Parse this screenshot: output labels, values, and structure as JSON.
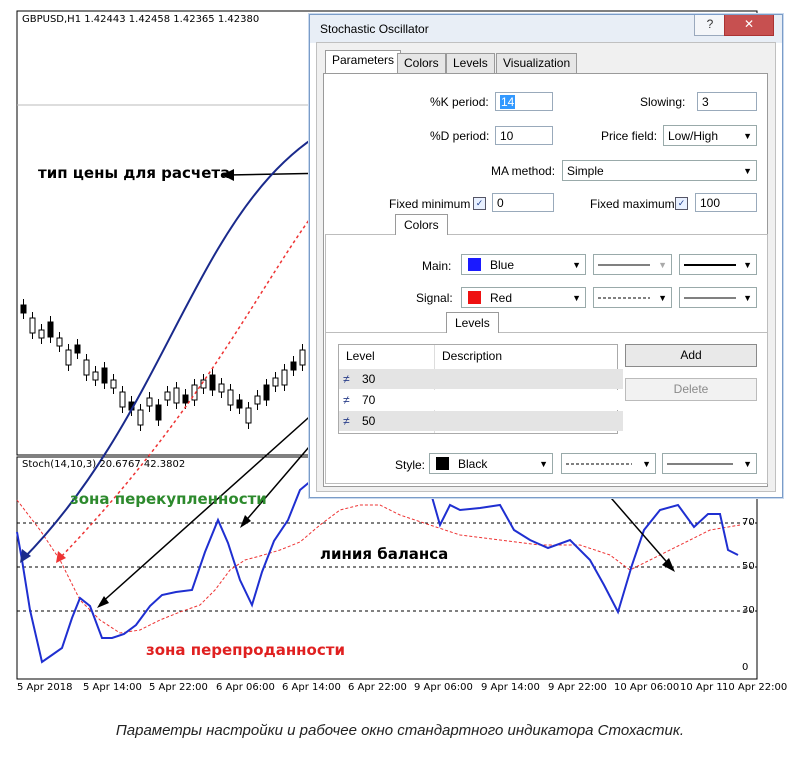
{
  "price_chart": {
    "title": "GBPUSD,H1  1.42443 1.42458 1.42365 1.42380"
  },
  "stoch_chart": {
    "title": "Stoch(14,10,3) 20.6767 42.3802",
    "y_ticks": [
      "70",
      "50",
      "30",
      "0"
    ],
    "x_ticks": [
      "5 Apr 2018",
      "5 Apr 14:00",
      "5 Apr 22:00",
      "6 Apr 06:00",
      "6 Apr 14:00",
      "6 Apr 22:00",
      "9 Apr 06:00",
      "9 Apr 14:00",
      "9 Apr 22:00",
      "10 Apr 06:00",
      "10 Apr 14:00",
      "10 Apr 22:00"
    ]
  },
  "annotations": {
    "price_type": "тип цены для расчета",
    "overbought": "зона перекупленности",
    "balance": "линия баланса",
    "oversold": "зона перепроданности"
  },
  "caption": "Параметры настройки и рабочее окно стандартного индикатора Стохастик.",
  "dialog": {
    "title": "Stochastic Oscillator",
    "help_glyph": "?",
    "close_glyph": "✕",
    "tabs": [
      "Parameters",
      "Colors",
      "Levels",
      "Visualization"
    ],
    "params": {
      "k_label": "%K period:",
      "k_value": "14",
      "d_label": "%D period:",
      "d_value": "10",
      "slowing_label": "Slowing:",
      "slowing_value": "3",
      "price_label": "Price field:",
      "price_value": "Low/High",
      "ma_label": "MA method:",
      "ma_value": "Simple",
      "fixed_min_label": "Fixed minimum",
      "fixed_min_value": "0",
      "fixed_max_label": "Fixed maximum",
      "fixed_max_value": "100",
      "check_glyph": "✓"
    },
    "colors_section": {
      "tab": "Colors",
      "main_label": "Main:",
      "main_color_name": "Blue",
      "main_color": "#1a1aff",
      "signal_label": "Signal:",
      "signal_color_name": "Red",
      "signal_color": "#ee1111"
    },
    "levels_section": {
      "tab": "Levels",
      "col_level": "Level",
      "col_desc": "Description",
      "rows": [
        {
          "level": "30",
          "desc": ""
        },
        {
          "level": "70",
          "desc": ""
        },
        {
          "level": "50",
          "desc": ""
        }
      ],
      "add_label": "Add",
      "delete_label": "Delete",
      "style_label": "Style:",
      "style_color_name": "Black",
      "style_color": "#000000"
    }
  }
}
